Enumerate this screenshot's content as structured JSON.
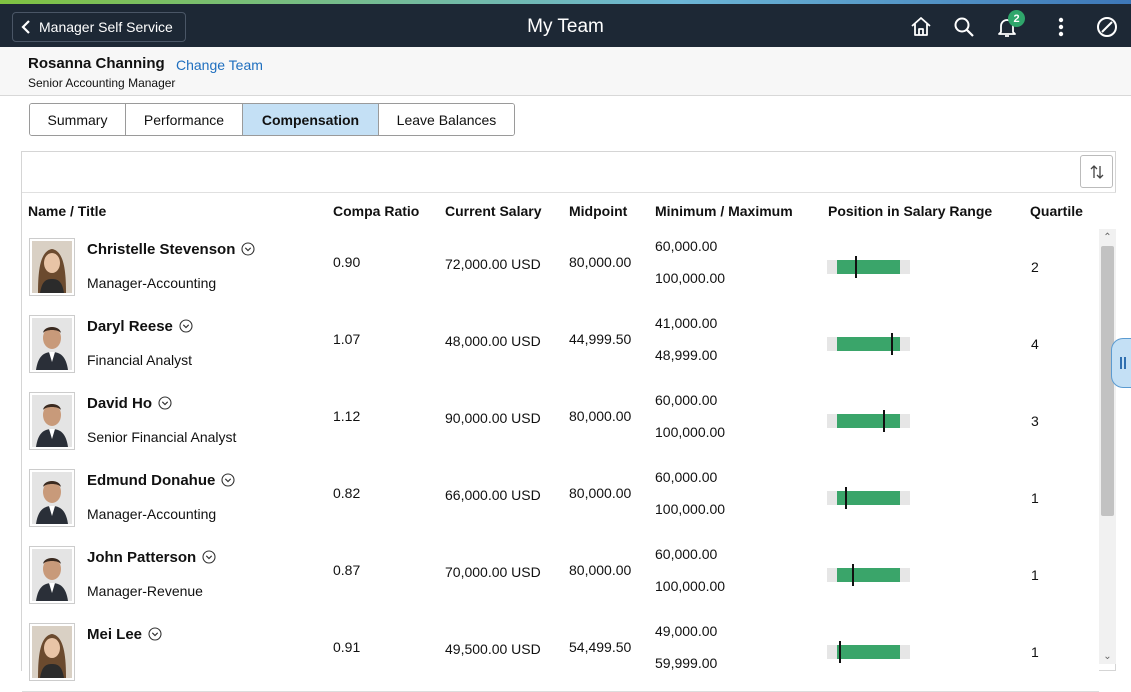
{
  "navbar": {
    "back_label": "Manager Self Service",
    "title": "My Team",
    "notification_count": "2"
  },
  "manager": {
    "name": "Rosanna Channing",
    "change_team_label": "Change Team",
    "title": "Senior Accounting Manager"
  },
  "tabs": [
    {
      "label": "Summary"
    },
    {
      "label": "Performance"
    },
    {
      "label": "Compensation",
      "active": true
    },
    {
      "label": "Leave Balances"
    }
  ],
  "columns": {
    "name": "Name / Title",
    "compa": "Compa Ratio",
    "salary": "Current Salary",
    "midpoint": "Midpoint",
    "minmax": "Minimum / Maximum",
    "position": "Position in Salary Range",
    "quartile": "Quartile"
  },
  "colors": {
    "navbar_bg": "#1d2835",
    "active_tab": "#c4e0f5",
    "range_fill": "#3aa56a",
    "link": "#1f6fbf"
  },
  "rows": [
    {
      "name": "Christelle Stevenson",
      "title": "Manager-Accounting",
      "compa": "0.90",
      "salary": "72,000.00 USD",
      "midpoint": "80,000.00",
      "min": "60,000.00",
      "max": "100,000.00",
      "quartile": "2",
      "salary_position": 0.3,
      "photo_icon": "female-portrait-icon"
    },
    {
      "name": "Daryl Reese",
      "title": "Financial Analyst",
      "compa": "1.07",
      "salary": "48,000.00 USD",
      "midpoint": "44,999.50",
      "min": "41,000.00",
      "max": "48,999.00",
      "quartile": "4",
      "salary_position": 0.875,
      "photo_icon": "male-portrait-icon"
    },
    {
      "name": "David Ho",
      "title": "Senior Financial Analyst",
      "compa": "1.12",
      "salary": "90,000.00 USD",
      "midpoint": "80,000.00",
      "min": "60,000.00",
      "max": "100,000.00",
      "quartile": "3",
      "salary_position": 0.75,
      "photo_icon": "male-portrait-icon"
    },
    {
      "name": "Edmund Donahue",
      "title": "Manager-Accounting",
      "compa": "0.82",
      "salary": "66,000.00 USD",
      "midpoint": "80,000.00",
      "min": "60,000.00",
      "max": "100,000.00",
      "quartile": "1",
      "salary_position": 0.15,
      "photo_icon": "male-portrait-icon"
    },
    {
      "name": "John Patterson",
      "title": "Manager-Revenue",
      "compa": "0.87",
      "salary": "70,000.00 USD",
      "midpoint": "80,000.00",
      "min": "60,000.00",
      "max": "100,000.00",
      "quartile": "1",
      "salary_position": 0.25,
      "photo_icon": "male-portrait-icon"
    },
    {
      "name": "Mei Lee",
      "title": "",
      "compa": "0.91",
      "salary": "49,500.00 USD",
      "midpoint": "54,499.50",
      "min": "49,000.00",
      "max": "59,999.00",
      "quartile": "1",
      "salary_position": 0.05,
      "photo_icon": "female-portrait-icon"
    }
  ]
}
